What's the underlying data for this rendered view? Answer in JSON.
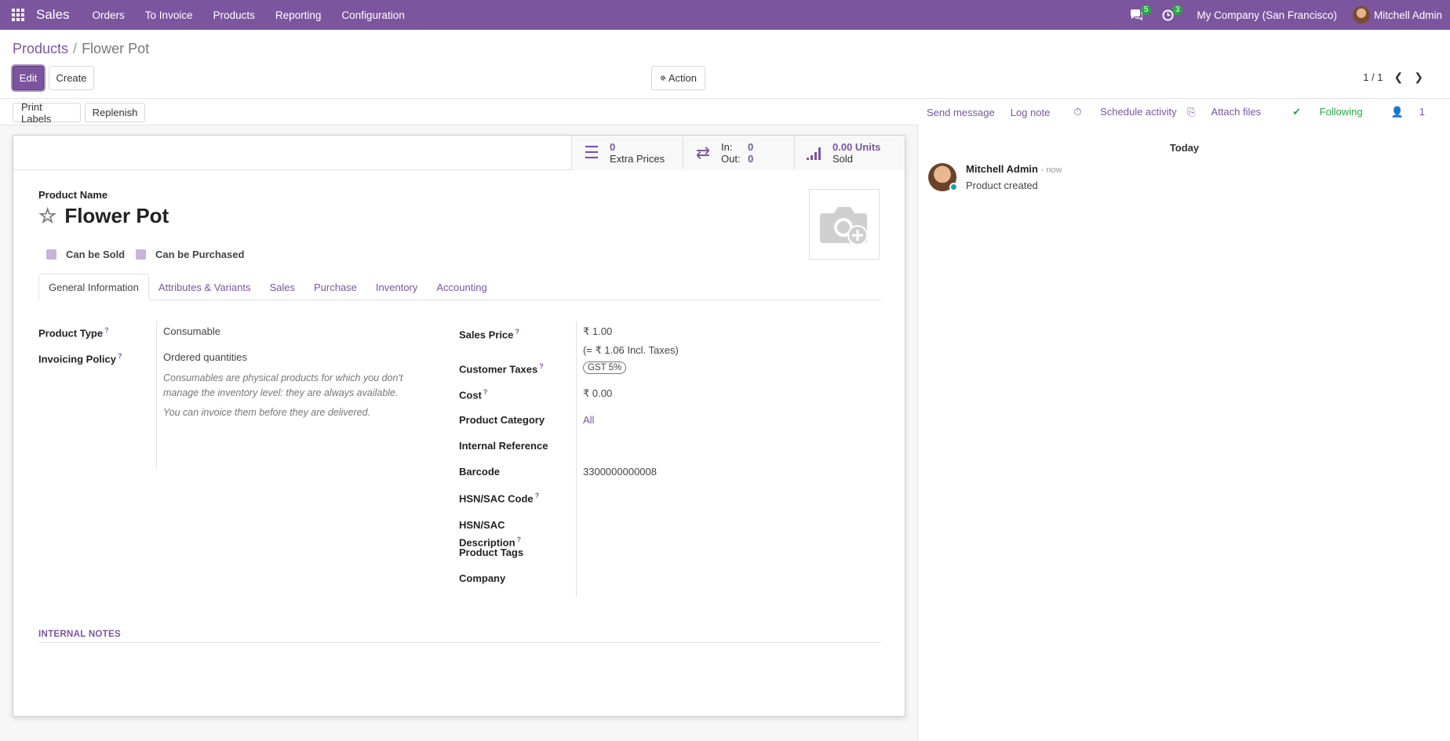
{
  "topbar": {
    "app_name": "Sales",
    "menu": [
      "Orders",
      "To Invoice",
      "Products",
      "Reporting",
      "Configuration"
    ],
    "messages_count": "5",
    "activities_count": "3",
    "company": "My Company (San Francisco)",
    "user": "Mitchell Admin"
  },
  "breadcrumb": {
    "parent": "Products",
    "separator": "/",
    "current": "Flower Pot"
  },
  "buttons": {
    "edit": "Edit",
    "create": "Create",
    "action": "Action",
    "print_labels": "Print Labels",
    "replenish": "Replenish"
  },
  "pager": {
    "value": "1 / 1"
  },
  "smart_buttons": {
    "extra_prices_num": "0",
    "extra_prices_label": "Extra Prices",
    "in_label": "In:",
    "in_val": "0",
    "out_label": "Out:",
    "out_val": "0",
    "sold_num": "0.00 Units",
    "sold_label": "Sold"
  },
  "product": {
    "name_label": "Product Name",
    "name": "Flower Pot",
    "can_be_sold": "Can be Sold",
    "can_be_purchased": "Can be Purchased"
  },
  "tabs": [
    "General Information",
    "Attributes & Variants",
    "Sales",
    "Purchase",
    "Inventory",
    "Accounting"
  ],
  "general": {
    "product_type_label": "Product Type",
    "product_type": "Consumable",
    "invoicing_policy_label": "Invoicing Policy",
    "invoicing_policy": "Ordered quantities",
    "hint1": "Consumables are physical products for which you don't manage the inventory level: they are always available.",
    "hint2": "You can invoice them before they are delivered.",
    "sales_price_label": "Sales Price",
    "sales_price": "₹ 1.00",
    "incl_taxes": "(= ₹ 1.06 Incl. Taxes)",
    "customer_taxes_label": "Customer Taxes",
    "customer_taxes": "GST 5%",
    "cost_label": "Cost",
    "cost": "₹ 0.00",
    "category_label": "Product Category",
    "category": "All",
    "internal_ref_label": "Internal Reference",
    "barcode_label": "Barcode",
    "barcode": "3300000000008",
    "hsn_code_label": "HSN/SAC Code",
    "hsn_desc_label_1": "HSN/SAC",
    "hsn_desc_label_2": "Description",
    "tags_label": "Product Tags",
    "company_label": "Company",
    "help_mark": "?"
  },
  "notes_label": "INTERNAL NOTES",
  "chatter": {
    "send_message": "Send message",
    "log_note": "Log note",
    "schedule_activity": "Schedule activity",
    "attach_files": "Attach files",
    "following": "Following",
    "followers": "1",
    "today": "Today",
    "author": "Mitchell Admin",
    "time": "- now",
    "body": "Product created"
  }
}
